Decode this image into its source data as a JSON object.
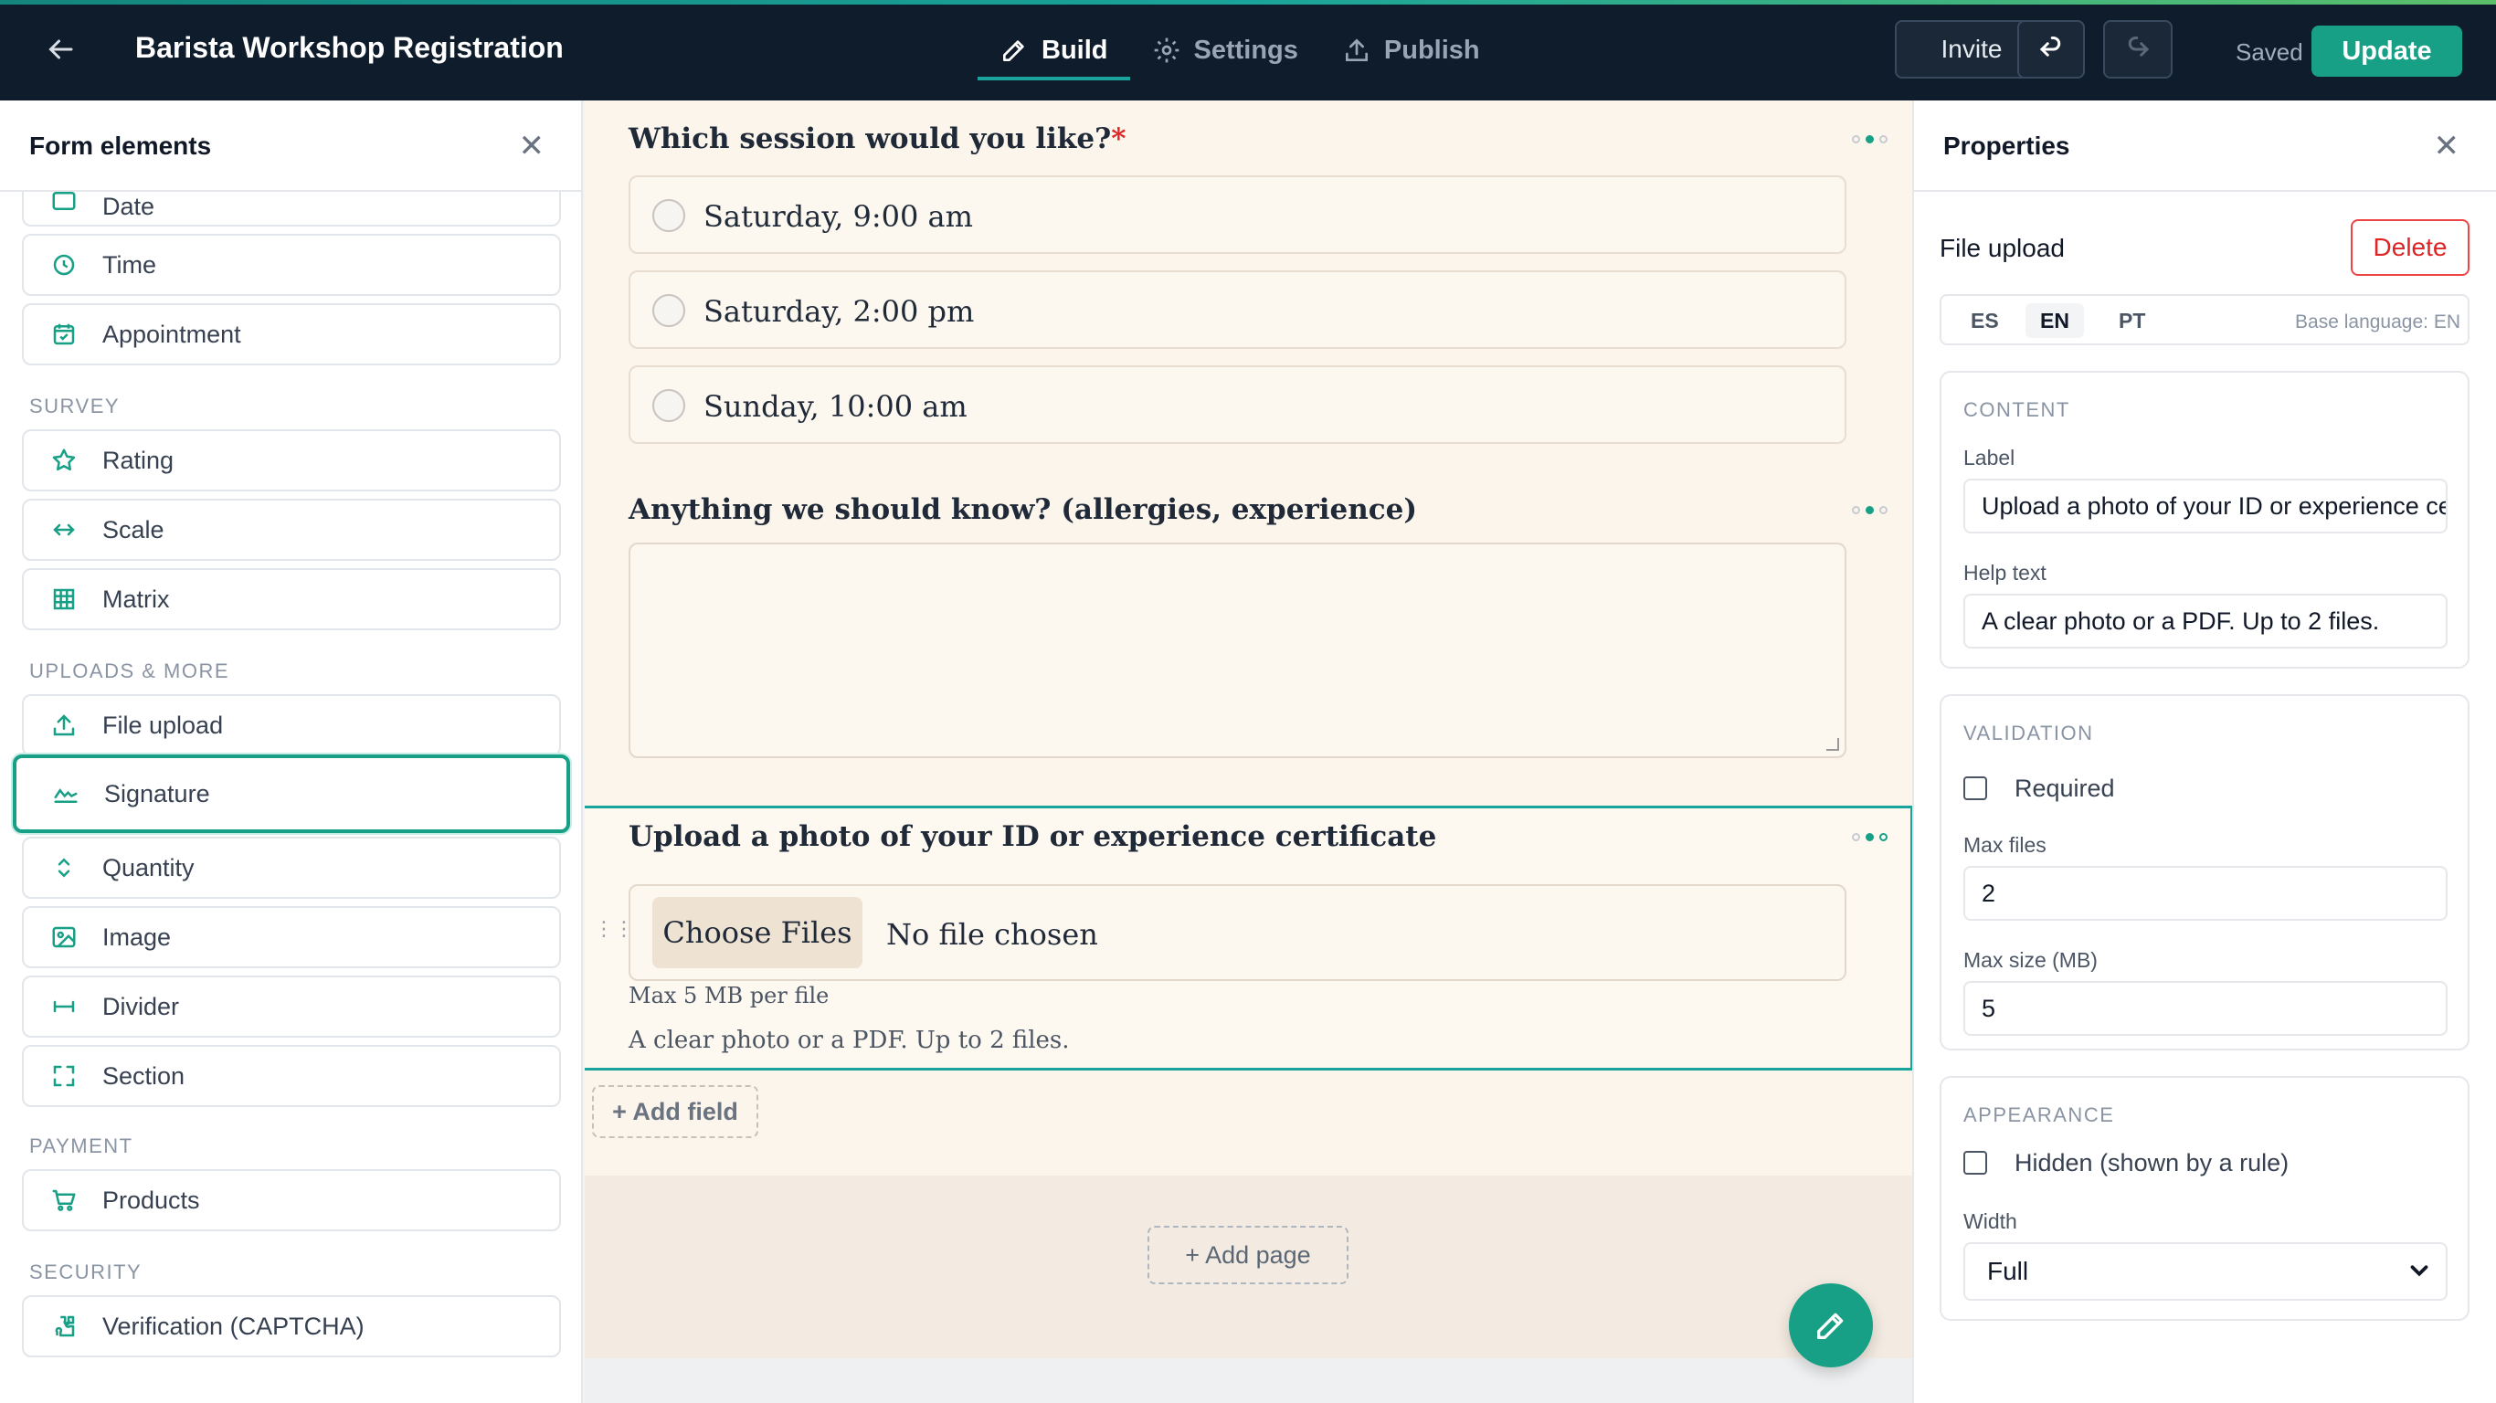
{
  "header": {
    "back_icon": "arrow-left-icon",
    "title": "Barista Workshop Registration",
    "tabs": [
      {
        "label": "Build",
        "icon": "pencil-icon",
        "active": true
      },
      {
        "label": "Settings",
        "icon": "gear-icon",
        "active": false
      },
      {
        "label": "Publish",
        "icon": "upload-icon",
        "active": false
      }
    ],
    "invite_label": "Invite",
    "undo_icon": "undo-icon",
    "redo_icon": "redo-icon",
    "saved_text": "Saved",
    "update_label": "Update"
  },
  "elements_panel": {
    "title": "Form elements",
    "close_icon": "close-icon",
    "items_top": [
      {
        "label": "Date",
        "icon": "calendar-icon"
      },
      {
        "label": "Time",
        "icon": "clock-icon"
      },
      {
        "label": "Appointment",
        "icon": "calendar-check-icon"
      }
    ],
    "survey_heading": "SURVEY",
    "survey": [
      {
        "label": "Rating",
        "icon": "star-icon"
      },
      {
        "label": "Scale",
        "icon": "arrows-horizontal-icon"
      },
      {
        "label": "Matrix",
        "icon": "grid-icon"
      }
    ],
    "uploads_heading": "UPLOADS & MORE",
    "uploads": [
      {
        "label": "File upload",
        "icon": "upload-icon"
      },
      {
        "label": "Signature",
        "icon": "signature-icon",
        "selected": true
      },
      {
        "label": "Quantity",
        "icon": "chevron-up-down-icon"
      },
      {
        "label": "Image",
        "icon": "image-icon"
      },
      {
        "label": "Divider",
        "icon": "divider-icon"
      },
      {
        "label": "Section",
        "icon": "section-frame-icon"
      }
    ],
    "payment_heading": "PAYMENT",
    "payment": [
      {
        "label": "Products",
        "icon": "cart-icon"
      }
    ],
    "security_heading": "SECURITY",
    "security": [
      {
        "label": "Verification (CAPTCHA)",
        "icon": "puzzle-icon"
      }
    ]
  },
  "canvas": {
    "q1": {
      "label": "Which session would you like?",
      "required_mark": "*",
      "options": [
        "Saturday, 9:00 am",
        "Saturday, 2:00 pm",
        "Sunday, 10:00 am"
      ]
    },
    "q2": {
      "label": "Anything we should know? (allergies, experience)"
    },
    "q3": {
      "label": "Upload a photo of your ID or experience certificate",
      "choose_files": "Choose Files",
      "no_file": "No file chosen",
      "max_per_file": "Max 5 MB per file",
      "help_text": "A clear photo or a PDF. Up to 2 files."
    },
    "add_field": "+ Add field",
    "add_page": "+ Add page",
    "fab_icon": "pencil-icon"
  },
  "properties": {
    "title": "Properties",
    "close_icon": "close-icon",
    "element_type": "File upload",
    "delete_label": "Delete",
    "languages": [
      "ES",
      "EN",
      "PT"
    ],
    "active_language": "EN",
    "base_language": "Base language: EN",
    "content": {
      "heading": "CONTENT",
      "label_label": "Label",
      "label_value": "Upload a photo of your ID or experience certificate",
      "help_label": "Help text",
      "help_value": "A clear photo or a PDF. Up to 2 files."
    },
    "validation": {
      "heading": "VALIDATION",
      "required_label": "Required",
      "required_checked": false,
      "max_files_label": "Max files",
      "max_files_value": "2",
      "max_size_label": "Max size (MB)",
      "max_size_value": "5"
    },
    "appearance": {
      "heading": "APPEARANCE",
      "hidden_label": "Hidden (shown by a rule)",
      "hidden_checked": false,
      "width_label": "Width",
      "width_value": "Full"
    }
  },
  "colors": {
    "accent": "#17a085",
    "topbar": "#0f1c2c",
    "canvas_bg": "#fbf5ec",
    "delete": "#dc2626"
  }
}
